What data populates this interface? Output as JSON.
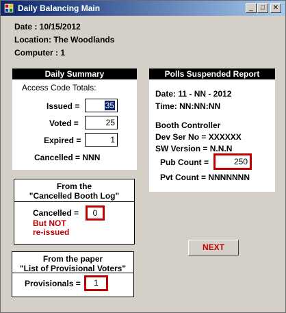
{
  "window": {
    "title": "Daily Balancing Main"
  },
  "header": {
    "date": "Date : 10/15/2012",
    "location": "Location: The Woodlands",
    "computer": "Computer : 1"
  },
  "daily_summary": {
    "title": "Daily Summary",
    "subtitle": "Access Code Totals:",
    "issued_label": "Issued =",
    "issued_value": "35",
    "voted_label": "Voted =",
    "voted_value": "25",
    "expired_label": "Expired =",
    "expired_value": "1",
    "cancelled": "Cancelled = NNN"
  },
  "polls_report": {
    "title": "Polls Suspended Report",
    "date": "Date:  11 - NN - 2012",
    "time": "Time: NN:NN:NN",
    "booth_controller": "Booth Controller",
    "dev_ser_no": "Dev Ser No = XXXXXX",
    "sw_version": "SW Version = N.N.N",
    "pub_count_label": "Pub Count =",
    "pub_count_value": "250",
    "pvt_count": "Pvt Count = NNNNNNN"
  },
  "cancelled_log": {
    "title_line1": "From the",
    "title_line2": "\"Cancelled Booth Log\"",
    "cancelled_label": "Cancelled =",
    "cancelled_value": "0",
    "note_line1": "But NOT",
    "note_line2": "re-issued"
  },
  "provisional": {
    "title_line1": "From the paper",
    "title_line2": "\"List of Provisional Voters\"",
    "label": "Provisionals =",
    "value": "1"
  },
  "buttons": {
    "next": "NEXT",
    "minimize": "_",
    "maximize": "□",
    "close": "✕"
  },
  "colors": {
    "title_start": "#0a246a",
    "title_end": "#a6caf0",
    "accent_red": "#c00000"
  }
}
